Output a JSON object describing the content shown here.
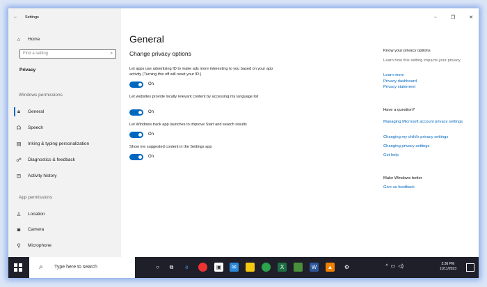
{
  "window": {
    "title": "Settings",
    "back_icon": "←",
    "controls": {
      "minimize": "–",
      "maximize": "❐",
      "close": "✕"
    }
  },
  "sidebar": {
    "home_label": "Home",
    "search_placeholder": "Find a setting",
    "privacy_label": "Privacy",
    "windows_permissions_label": "Windows permissions",
    "app_permissions_label": "App permissions",
    "items": [
      {
        "label": "General",
        "icon": "lock-icon"
      },
      {
        "label": "Speech",
        "icon": "speech-icon"
      },
      {
        "label": "Inking & typing personalization",
        "icon": "notepad-icon"
      },
      {
        "label": "Diagnostics & feedback",
        "icon": "feedback-icon"
      },
      {
        "label": "Activity history",
        "icon": "history-icon"
      }
    ],
    "app_items": [
      {
        "label": "Location",
        "icon": "location-icon"
      },
      {
        "label": "Camera",
        "icon": "camera-icon"
      },
      {
        "label": "Microphone",
        "icon": "microphone-icon"
      }
    ]
  },
  "main": {
    "title": "General",
    "subtitle": "Change privacy options",
    "options": [
      {
        "description": "Let apps use advertising ID to make ads more interesting to you based on your app activity (Turning this off will reset your ID.)",
        "state": "On"
      },
      {
        "description": "Let websites provide locally relevant content by accessing my language list",
        "state": "On"
      },
      {
        "description": "Let Windows track app launches to improve Start and search results",
        "state": "On"
      },
      {
        "description": "Show me suggested content in the Settings app",
        "state": "On"
      }
    ]
  },
  "right": {
    "know_heading": "Know your privacy options",
    "know_text": "Learn how this setting impacts your privacy.",
    "links1": [
      "Learn more",
      "Privacy dashboard",
      "Privacy statement"
    ],
    "question_heading": "Have a question?",
    "links2": [
      "Managing Microsoft account privacy settings",
      "Changing my child's privacy settings",
      "Changing privacy settings",
      "Get help"
    ],
    "better_heading": "Make Windows better",
    "feedback_link": "Give us feedback"
  },
  "taskbar": {
    "search_text": "Type here to search",
    "time": "3:36 PM",
    "date": "11/11/2023",
    "accent": "#0067c0"
  }
}
